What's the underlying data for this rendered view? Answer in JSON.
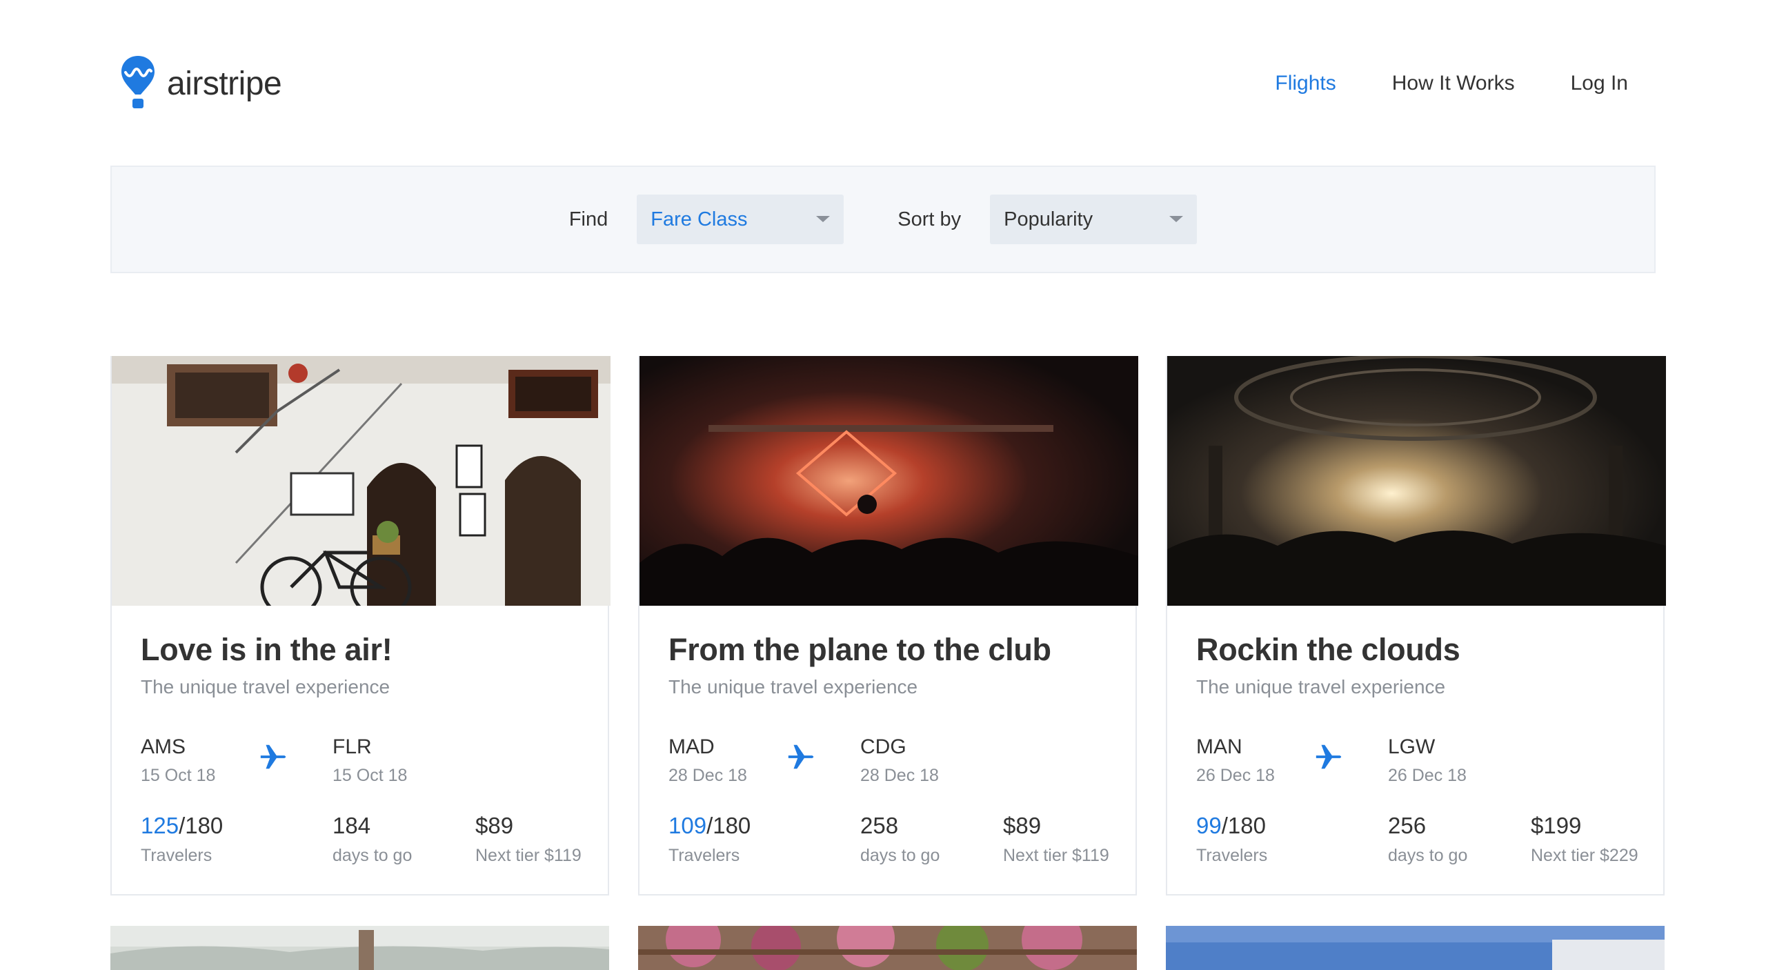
{
  "brand": {
    "name": "airstripe",
    "accent": "#1f7ae0"
  },
  "nav": {
    "items": [
      {
        "label": "Flights",
        "active": true
      },
      {
        "label": "How It Works",
        "active": false
      },
      {
        "label": "Log In",
        "active": false
      }
    ]
  },
  "filters": {
    "find_label": "Find",
    "find_value": "Fare Class",
    "sort_label": "Sort by",
    "sort_value": "Popularity"
  },
  "cards": [
    {
      "title": "Love is in the air!",
      "subtitle": "The unique travel experience",
      "from": {
        "code": "AMS",
        "date": "15 Oct 18"
      },
      "to": {
        "code": "FLR",
        "date": "15 Oct 18"
      },
      "travelers_current": "125",
      "travelers_total": "/180",
      "travelers_label": "Travelers",
      "days": "184",
      "days_label": "days to go",
      "price": "$89",
      "next_tier": "Next tier $119",
      "image": "street-bicycle-photo"
    },
    {
      "title": "From the plane to the club",
      "subtitle": "The unique travel experience",
      "from": {
        "code": "MAD",
        "date": "28 Dec 18"
      },
      "to": {
        "code": "CDG",
        "date": "28 Dec 18"
      },
      "travelers_current": "109",
      "travelers_total": "/180",
      "travelers_label": "Travelers",
      "days": "258",
      "days_label": "days to go",
      "price": "$89",
      "next_tier": "Next tier $119",
      "image": "club-dj-photo"
    },
    {
      "title": "Rockin the clouds",
      "subtitle": "The unique travel experience",
      "from": {
        "code": "MAN",
        "date": "26 Dec 18"
      },
      "to": {
        "code": "LGW",
        "date": "26 Dec 18"
      },
      "travelers_current": "99",
      "travelers_total": "/180",
      "travelers_label": "Travelers",
      "days": "256",
      "days_label": "days to go",
      "price": "$199",
      "next_tier": "Next tier $229",
      "image": "concert-crowd-photo"
    }
  ]
}
